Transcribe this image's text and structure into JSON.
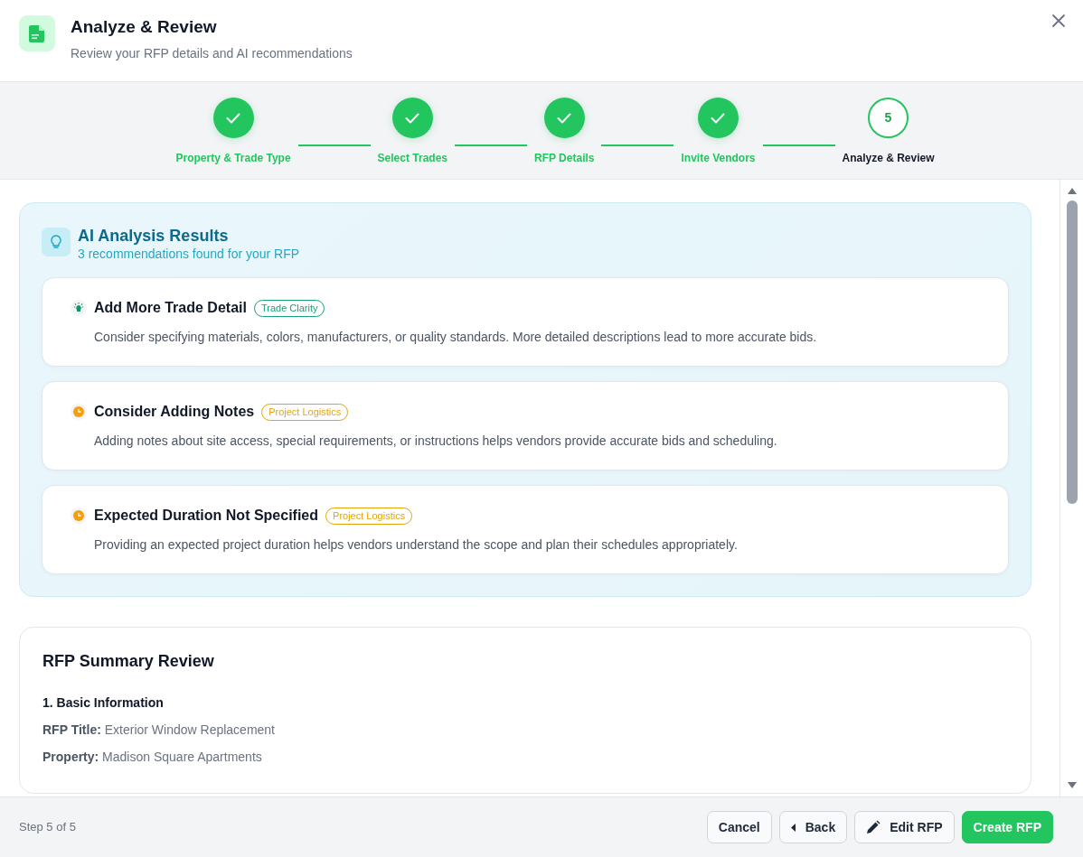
{
  "header": {
    "title": "Analyze & Review",
    "subtitle": "Review your RFP details and AI recommendations"
  },
  "steps": [
    {
      "label": "Property & Trade Type",
      "completed": true,
      "selected": false
    },
    {
      "label": "Select Trades",
      "completed": true,
      "selected": false
    },
    {
      "label": "RFP Details",
      "completed": true,
      "selected": false
    },
    {
      "label": "Invite Vendors",
      "completed": true,
      "selected": false
    },
    {
      "label": "Analyze & Review",
      "number": "5",
      "completed": false,
      "selected": true
    }
  ],
  "analysis": {
    "title": "AI Analysis Results",
    "subtitle": "3 recommendations found for your RFP",
    "recommendations": [
      {
        "kind": "clarity",
        "title": "Add More Trade Detail",
        "tag": "Trade Clarity",
        "text": "Consider specifying materials, colors, manufacturers, or quality standards. More detailed descriptions lead to more accurate bids."
      },
      {
        "kind": "logistics",
        "title": "Consider Adding Notes",
        "tag": "Project Logistics",
        "text": "Adding notes about site access, special requirements, or instructions helps vendors provide accurate bids and scheduling."
      },
      {
        "kind": "logistics",
        "title": "Expected Duration Not Specified",
        "tag": "Project Logistics",
        "text": "Providing an expected project duration helps vendors understand the scope and plan their schedules appropriately."
      }
    ]
  },
  "summary": {
    "title": "RFP Summary Review",
    "section": "1. Basic Information",
    "fields": [
      "**RFP Title:** Exterior Window Replacement",
      "**Property:** Madison Square Apartments"
    ]
  },
  "footer": {
    "step_text": "Step 5 of 5",
    "buttons": [
      {
        "kind": "cancel",
        "label": "Cancel"
      },
      {
        "kind": "back",
        "label": "Back"
      },
      {
        "kind": "edit",
        "label": "Edit RFP"
      },
      {
        "kind": "create",
        "label": "Create RFP"
      }
    ]
  }
}
